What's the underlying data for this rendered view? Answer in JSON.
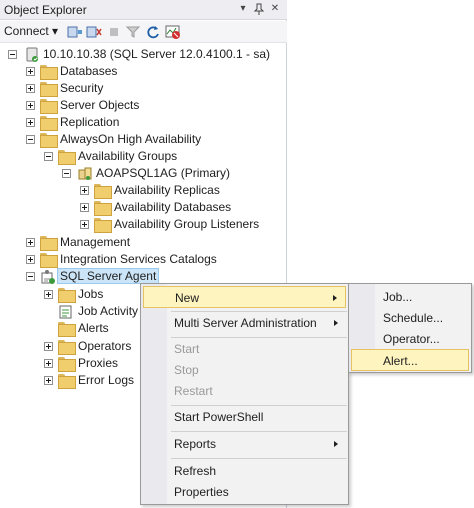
{
  "panel": {
    "title": "Object Explorer",
    "title_buttons": {
      "dropdown": "▾",
      "pin": "ᵖ",
      "close": "✕"
    },
    "toolbar": {
      "connect_label": "Connect ▾"
    }
  },
  "tree": {
    "server": "10.10.10.38 (SQL Server 12.0.4100.1 - sa)",
    "databases": "Databases",
    "security": "Security",
    "server_objects": "Server Objects",
    "replication": "Replication",
    "alwayson": "AlwaysOn High Availability",
    "availability_groups": "Availability Groups",
    "ag": "AOAPSQL1AG (Primary)",
    "replicas": "Availability Replicas",
    "av_databases": "Availability Databases",
    "listeners": "Availability Group Listeners",
    "management": "Management",
    "integration": "Integration Services Catalogs",
    "agent": "SQL Server Agent",
    "jobs": "Jobs",
    "job_activity": "Job Activity",
    "alerts": "Alerts",
    "operators": "Operators",
    "proxies": "Proxies",
    "error_logs": "Error Logs"
  },
  "context_menu": {
    "new": "New",
    "multi_server": "Multi Server Administration",
    "start": "Start",
    "stop": "Stop",
    "restart": "Restart",
    "powershell": "Start PowerShell",
    "reports": "Reports",
    "refresh": "Refresh",
    "properties": "Properties"
  },
  "submenu": {
    "job": "Job...",
    "schedule": "Schedule...",
    "operator": "Operator...",
    "alert": "Alert..."
  },
  "colors": {
    "menu_highlight": "#fdf4bf",
    "selection": "#cce4f7",
    "folder": "#f0cd6d"
  }
}
